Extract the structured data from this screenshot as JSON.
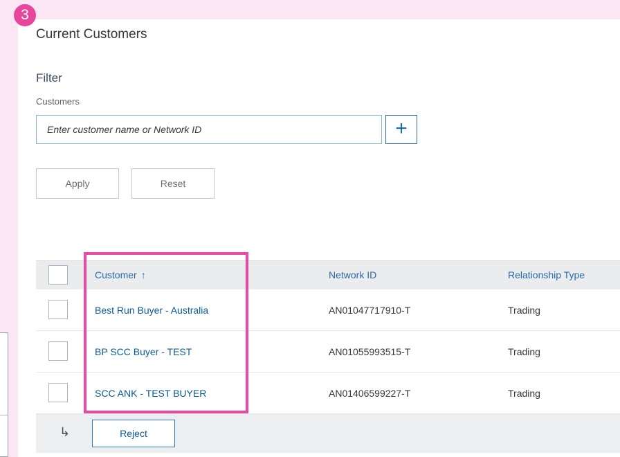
{
  "step": {
    "number": "3"
  },
  "page": {
    "title": "Current Customers"
  },
  "filter": {
    "title": "Filter",
    "customers_label": "Customers",
    "customers_placeholder": "Enter customer name or Network ID",
    "add_label": "+",
    "apply_label": "Apply",
    "reset_label": "Reset"
  },
  "table": {
    "columns": {
      "customer": "Customer",
      "customer_sort": "↑",
      "network_id": "Network ID",
      "relationship_type": "Relationship Type"
    },
    "rows": [
      {
        "customer": "Best Run Buyer - Australia",
        "network_id": "AN01047717910-T",
        "relationship_type": "Trading"
      },
      {
        "customer": "BP SCC Buyer - TEST",
        "network_id": "AN01055993515-T",
        "relationship_type": "Trading"
      },
      {
        "customer": "SCC ANK - TEST BUYER",
        "network_id": "AN01406599227-T",
        "relationship_type": "Trading"
      }
    ]
  },
  "actions": {
    "return_icon": "↳",
    "reject_label": "Reject"
  },
  "colors": {
    "highlight": "#ec4aa2",
    "badge": "#e8459c",
    "link": "#0a5a96",
    "background": "#fbe7f4"
  }
}
